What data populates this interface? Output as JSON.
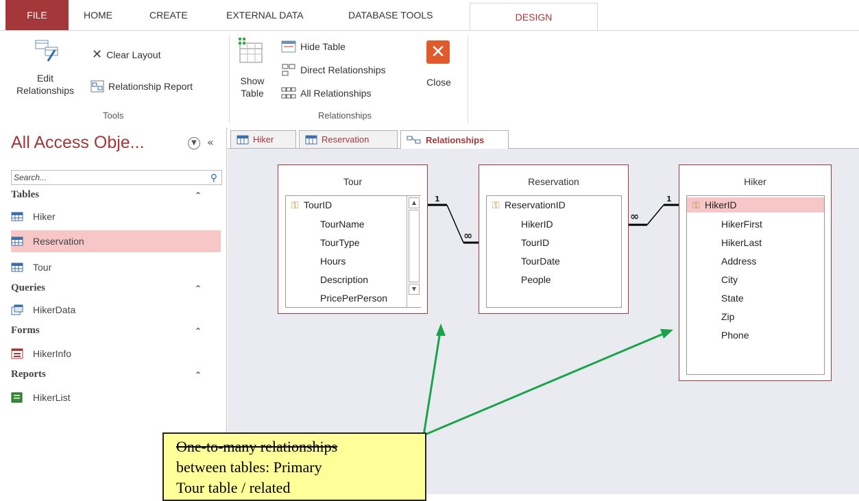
{
  "ribbon_tabs": {
    "file": "FILE",
    "home": "HOME",
    "create": "CREATE",
    "external_data": "EXTERNAL DATA",
    "database_tools": "DATABASE TOOLS",
    "design": "DESIGN"
  },
  "tools_group": {
    "edit_line1": "Edit",
    "edit_line2": "Relationships",
    "clear_layout": "Clear Layout",
    "relationship_report": "Relationship Report",
    "label": "Tools"
  },
  "relationships_group": {
    "show_line1": "Show",
    "show_line2": "Table",
    "hide_table": "Hide Table",
    "direct_relationships": "Direct Relationships",
    "all_relationships": "All Relationships",
    "close": "Close",
    "label": "Relationships"
  },
  "nav": {
    "title": "All Access Obje...",
    "search_placeholder": "Search...",
    "sections": {
      "tables": "Tables",
      "queries": "Queries",
      "forms": "Forms",
      "reports": "Reports"
    },
    "tables": [
      "Hiker",
      "Reservation",
      "Tour"
    ],
    "queries": [
      "HikerData"
    ],
    "forms": [
      "HikerInfo"
    ],
    "reports": [
      "HikerList"
    ]
  },
  "doc_tabs": {
    "hiker": "Hiker",
    "reservation": "Reservation",
    "relationships": "Relationships"
  },
  "tables": {
    "tour": {
      "title": "Tour",
      "fields": [
        "TourID",
        "TourName",
        "TourType",
        "Hours",
        "Description",
        "PricePerPerson"
      ]
    },
    "reservation": {
      "title": "Reservation",
      "fields": [
        "ReservationID",
        "HikerID",
        "TourID",
        "TourDate",
        "People"
      ]
    },
    "hiker": {
      "title": "Hiker",
      "fields": [
        "HikerID",
        "HikerFirst",
        "HikerLast",
        "Address",
        "City",
        "State",
        "Zip",
        "Phone"
      ]
    }
  },
  "relationship_marks": {
    "one": "1",
    "many": "∞"
  },
  "callout": {
    "line1": "One-to-many relationships",
    "line2": "between tables: Primary",
    "line3": "Tour table / related"
  },
  "colors": {
    "accent": "#a4373a",
    "selected": "#f7c6c7",
    "canvas": "#e9ebf0",
    "callout": "#ffff99",
    "arrow": "#1aa34a"
  },
  "icons": [
    "edit-relationships-icon",
    "clear-layout-icon",
    "relationship-report-icon",
    "show-table-icon",
    "hide-table-icon",
    "direct-relationships-icon",
    "all-relationships-icon",
    "close-icon",
    "dropdown-icon",
    "collapse-icon",
    "search-icon",
    "table-icon",
    "query-icon",
    "form-icon",
    "report-icon",
    "key-icon"
  ]
}
